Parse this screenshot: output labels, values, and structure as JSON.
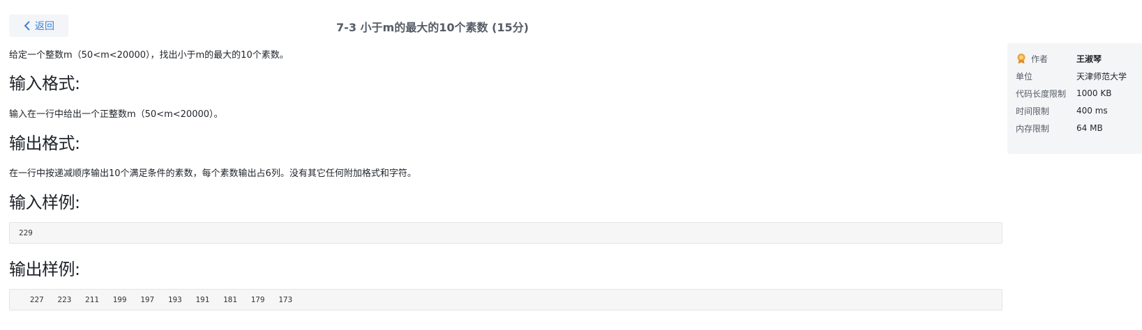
{
  "nav": {
    "back_label": "返回"
  },
  "problem": {
    "title": "7-3 小于m的最大的10个素数 (15分)",
    "intro": "给定一个整数m（50<m<20000），找出小于m的最大的10个素数。",
    "input_heading": "输入格式:",
    "input_text": "输入在一行中给出一个正整数m（50<m<20000）。",
    "output_heading": "输出格式:",
    "output_text": "在一行中按递减顺序输出10个满足条件的素数，每个素数输出占6列。没有其它任何附加格式和字符。",
    "sample_input_heading": "输入样例:",
    "sample_input": "229",
    "sample_output_heading": "输出样例:",
    "sample_output": [
      "227",
      "223",
      "211",
      "199",
      "197",
      "193",
      "191",
      "181",
      "179",
      "173"
    ]
  },
  "info": {
    "author_label": "作者",
    "author": "王淑琴",
    "unit_label": "单位",
    "unit": "天津师范大学",
    "code_limit_label": "代码长度限制",
    "code_limit": "1000 KB",
    "time_limit_label": "时间限制",
    "time_limit": "400 ms",
    "memory_limit_label": "内存限制",
    "memory_limit": "64 MB"
  },
  "colors": {
    "accent": "#3b82d9",
    "medal": "#f0a23b"
  }
}
